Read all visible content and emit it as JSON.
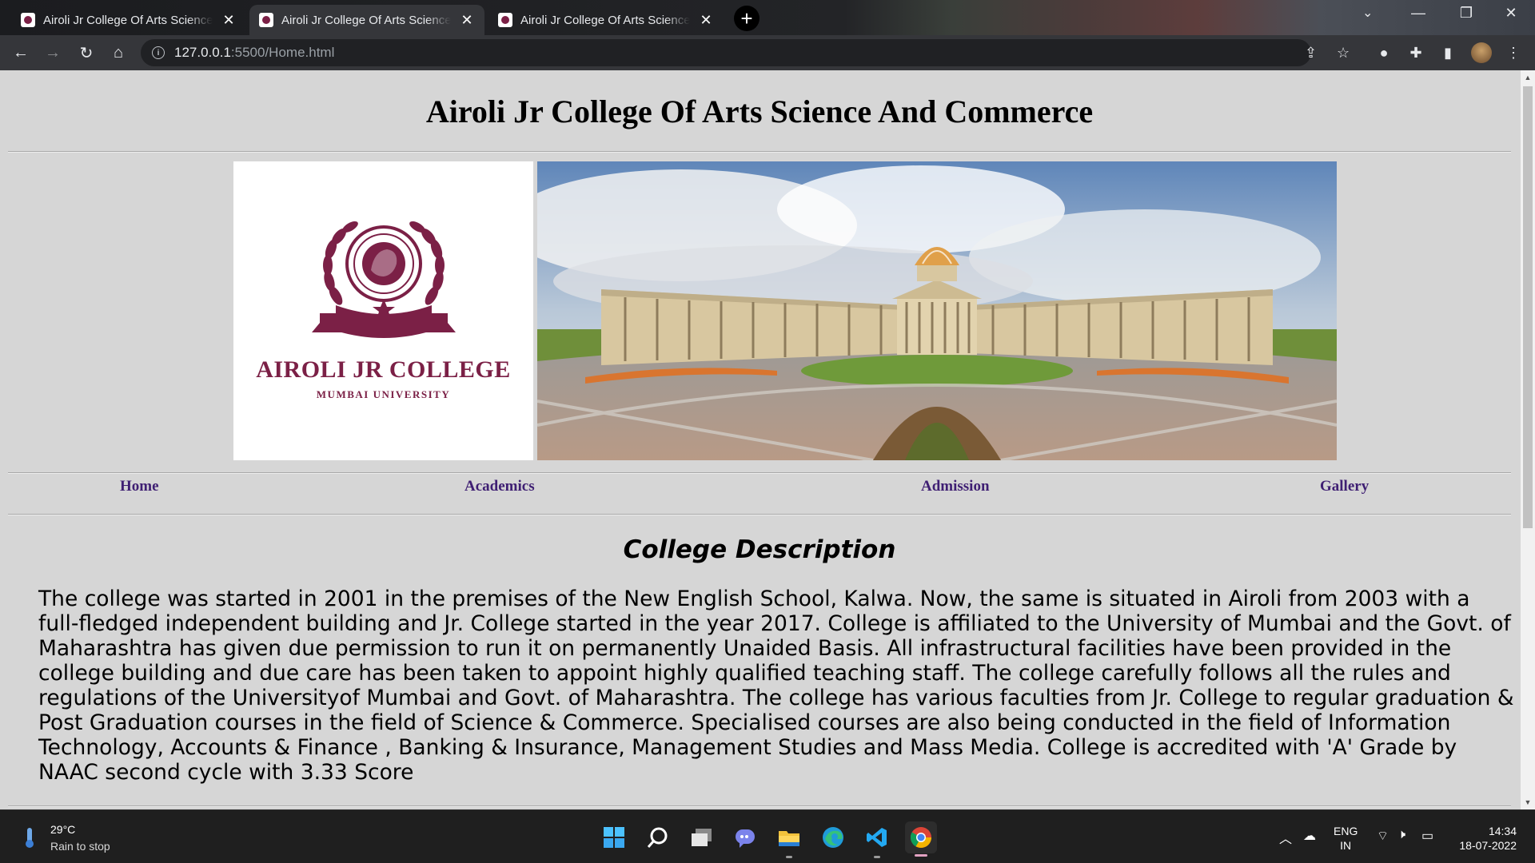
{
  "browser": {
    "tabs": [
      {
        "title": "Airoli Jr College Of Arts Science And Commerce",
        "state": "inactive"
      },
      {
        "title": "Airoli Jr College Of Arts Science And Commerce",
        "state": "active"
      },
      {
        "title": "Airoli Jr College Of Arts Science And Commerce",
        "state": "inactive"
      }
    ],
    "new_tab": "+",
    "url_host": "127.0.0.1",
    "url_path": ":5500/Home.html"
  },
  "page": {
    "title": "Airoli Jr College Of Arts Science And Commerce",
    "logo": {
      "name": "AIROLI JR COLLEGE",
      "subtitle": "MUMBAI UNIVERSITY"
    },
    "nav": [
      "Home",
      "Academics",
      "Admission",
      "Gallery"
    ],
    "description_title": "College Description",
    "description": "The college was started in 2001 in the premises of the New English School, Kalwa. Now, the same is situated in Airoli from 2003 with a full-fledged independent building and Jr. College started in the year 2017. College is affiliated to the University of Mumbai and the Govt. of Maharashtra has given due permission to run it on permanently Unaided Basis. All infrastructural facilities have been provided in the college building and due care has been taken to appoint highly qualified teaching staff. The college carefully follows all the rules and regulations of the Universityof Mumbai and Govt. of Maharashtra. The college has various faculties from Jr. College to regular graduation & Post Graduation courses in the field of Science & Commerce. Specialised courses are also being conducted in the field of Information Technology, Accounts & Finance , Banking & Insurance, Management Studies and Mass Media. College is accredited with 'A' Grade by NAAC second cycle with 3.33 Score"
  },
  "taskbar": {
    "weather_temp": "29°C",
    "weather_desc": "Rain to stop",
    "lang_line1": "ENG",
    "lang_line2": "IN",
    "time": "14:34",
    "date": "18-07-2022"
  },
  "colors": {
    "brand": "#7b2046",
    "nav_link": "#3f1f73",
    "page_bg": "#d6d6d6"
  }
}
